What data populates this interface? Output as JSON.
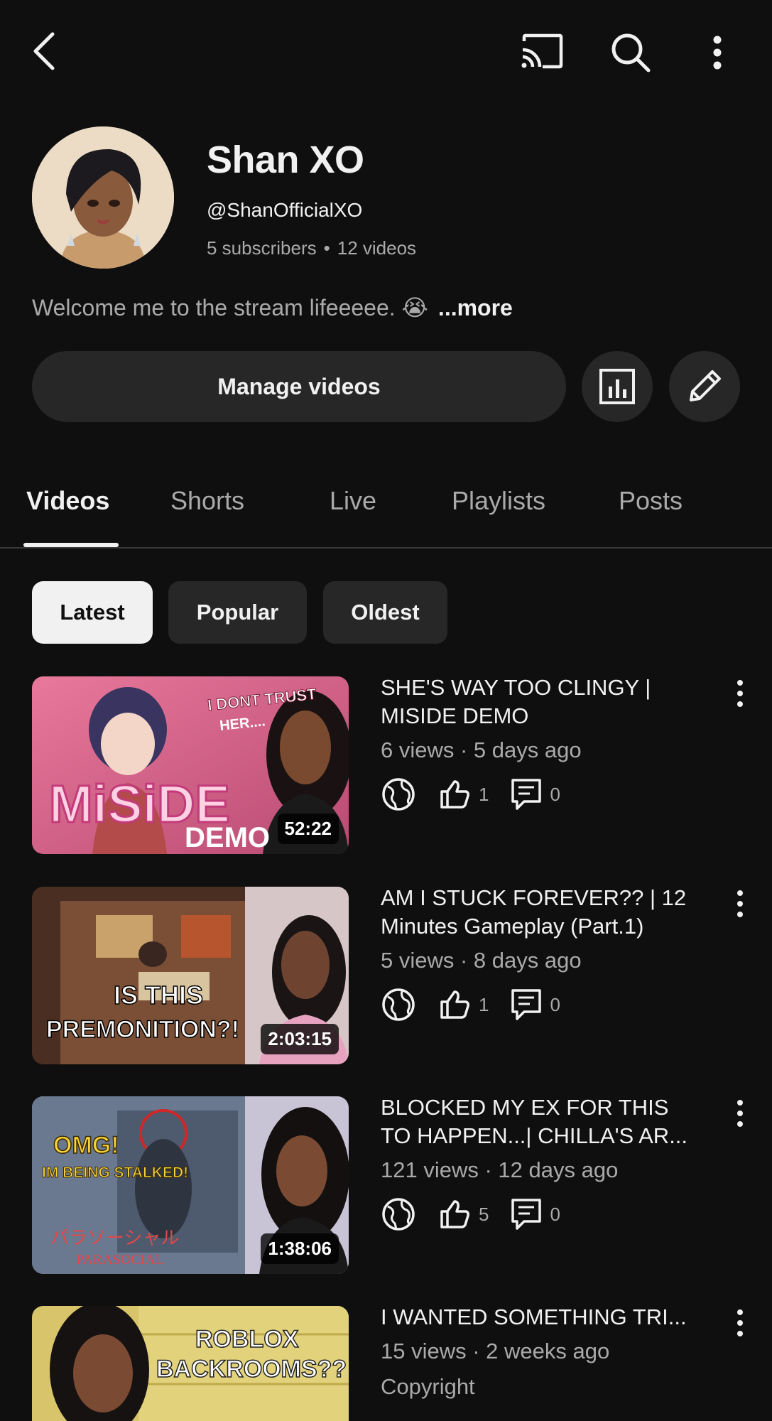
{
  "topbar": {
    "back_icon": "back-arrow-icon",
    "cast_icon": "cast-icon",
    "search_icon": "search-icon",
    "more_icon": "more-vertical-icon"
  },
  "channel": {
    "name": "Shan XO",
    "handle": "@ShanOfficialXO",
    "subscribers": "5 subscribers",
    "separator": "•",
    "videos_count": "12 videos",
    "description": "Welcome me to the stream lifeeeee. 😭",
    "more_label": "...more",
    "manage_videos_label": "Manage videos",
    "analytics_icon": "analytics-icon",
    "edit_icon": "pencil-icon"
  },
  "tabs": [
    {
      "label": "Videos",
      "active": true
    },
    {
      "label": "Shorts",
      "active": false
    },
    {
      "label": "Live",
      "active": false
    },
    {
      "label": "Playlists",
      "active": false
    },
    {
      "label": "Posts",
      "active": false
    }
  ],
  "chips": [
    {
      "label": "Latest",
      "selected": true
    },
    {
      "label": "Popular",
      "selected": false
    },
    {
      "label": "Oldest",
      "selected": false
    }
  ],
  "videos": [
    {
      "title_line1": "SHE'S WAY TOO CLINGY |",
      "title_line2": "MISIDE DEMO",
      "meta": "6 views · 5 days ago",
      "likes": "1",
      "comments": "0",
      "duration": "52:22",
      "thumb_text1": "I DONT TRUST",
      "thumb_text2": "HER....",
      "thumb_text3": "MiSiDE",
      "thumb_text4": "DEMO"
    },
    {
      "title_line1": "AM I STUCK FOREVER?? | 12",
      "title_line2": "Minutes Gameplay (Part.1)",
      "meta": "5 views · 8 days ago",
      "likes": "1",
      "comments": "0",
      "duration": "2:03:15",
      "thumb_text1": "IS THIS",
      "thumb_text2": "PREMONITION?!"
    },
    {
      "title_line1": "BLOCKED MY EX FOR THIS",
      "title_line2": "TO HAPPEN...| CHILLA'S AR...",
      "meta": "121 views · 12 days ago",
      "likes": "5",
      "comments": "0",
      "duration": "1:38:06",
      "thumb_text1": "OMG!",
      "thumb_text2": "IM BEING STALKED!",
      "thumb_text3": "パラソーシャル",
      "thumb_text4": "PARASOCIAL"
    },
    {
      "title_line1": "I WANTED SOMETHING TRI...",
      "meta": "15 views · 2 weeks ago",
      "meta2": "Copyright",
      "thumb_text1": "ROBLOX",
      "thumb_text2": "BACKROOMS??"
    }
  ],
  "colors": {
    "background": "#0f0f0f",
    "surface": "#272727",
    "text_primary": "#f1f1f1",
    "text_secondary": "#aaaaaa"
  }
}
